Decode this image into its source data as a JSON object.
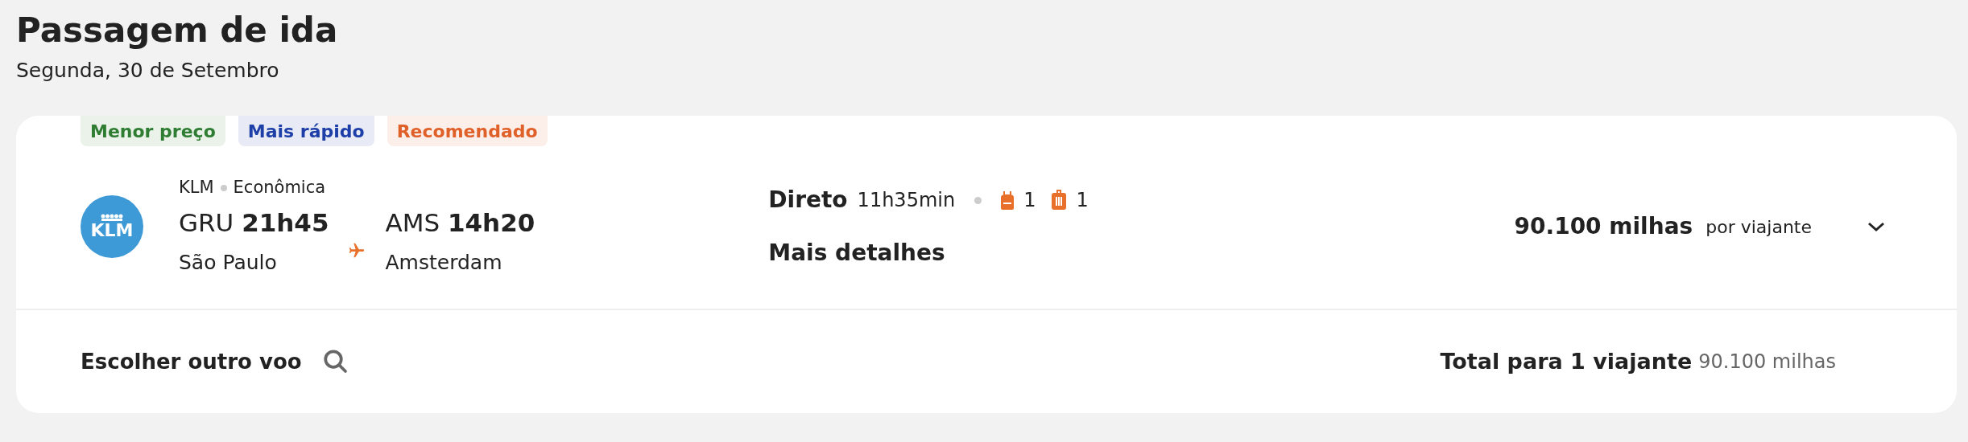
{
  "header": {
    "title": "Passagem de ida",
    "date": "Segunda, 30 de Setembro"
  },
  "flight": {
    "badges": [
      {
        "label": "Menor preço",
        "color": "#2e7d32"
      },
      {
        "label": "Mais rápido",
        "color": "#1e3fa8"
      },
      {
        "label": "Recomendado",
        "color": "#e0602a"
      }
    ],
    "logo_text": "KLM",
    "airline": "KLM",
    "cabin": "Econômica",
    "origin": {
      "code": "GRU",
      "time": "21h45",
      "city": "São Paulo"
    },
    "destination": {
      "code": "AMS",
      "time": "14h20",
      "city": "Amsterdam"
    },
    "stops": "Direto",
    "duration": "11h35min",
    "backpack_count": "1",
    "suitcase_count": "1",
    "details_link": "Mais detalhes",
    "price": "90.100 milhas",
    "price_unit": "por viajante",
    "expanded": false
  },
  "footer": {
    "change_flight": "Escolher outro voo",
    "total_label": "Total para 1 viajante",
    "total_value": "90.100 milhas"
  }
}
